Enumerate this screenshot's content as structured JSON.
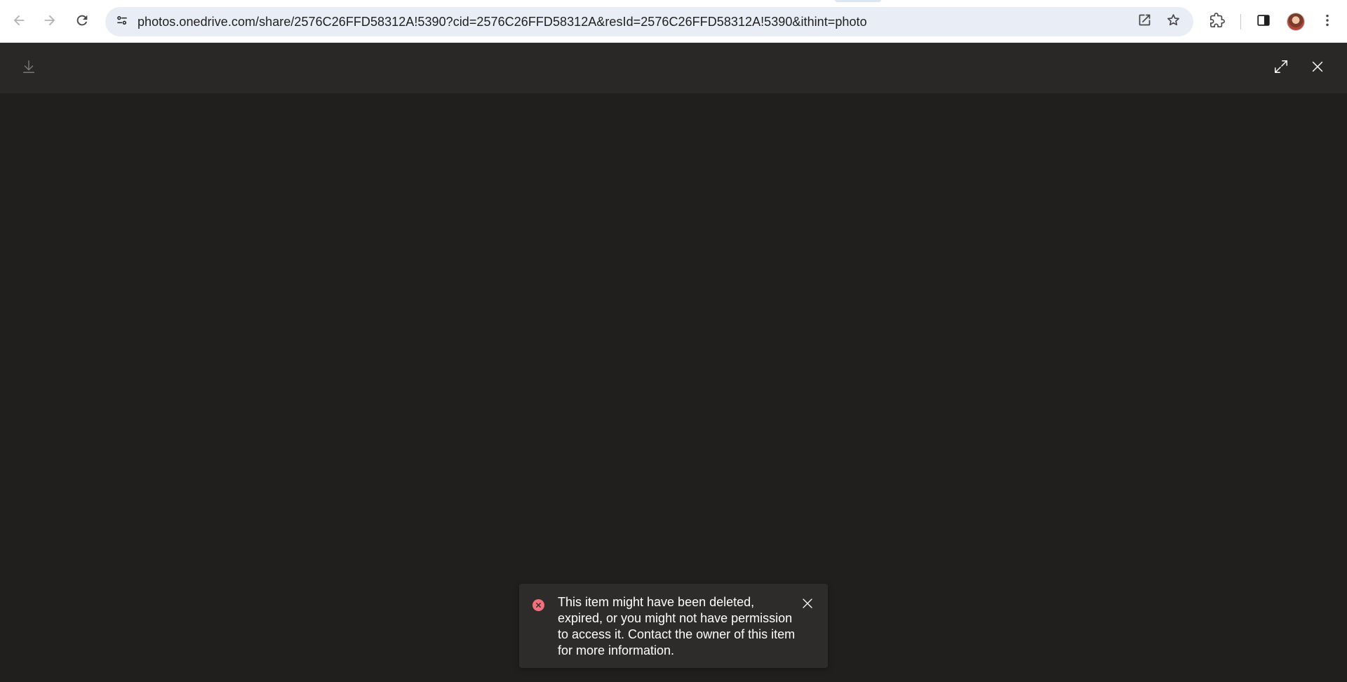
{
  "browser": {
    "url": "photos.onedrive.com/share/2576C26FFD58312A!5390?cid=2576C26FFD58312A&resId=2576C26FFD58312A!5390&ithint=photo",
    "icons": {
      "back": "arrow-left-icon",
      "forward": "arrow-right-icon",
      "reload": "reload-icon",
      "site_info": "tune-icon",
      "open_in_app": "open-external-icon",
      "bookmark": "star-icon",
      "extensions": "puzzle-icon",
      "side_panel": "side-panel-icon",
      "profile": "avatar",
      "menu": "kebab-menu-icon"
    }
  },
  "viewer": {
    "icons": {
      "download": "download-icon",
      "fullscreen": "expand-icon",
      "close": "close-icon"
    }
  },
  "toast": {
    "message": "This item might have been deleted, expired, or you might not have permission to access it. Contact the owner of this item for more information.",
    "icon": "error-icon",
    "error_color": "#f1707b"
  },
  "colors": {
    "chrome_bg": "#ffffff",
    "omnibox_bg": "#e9eef6",
    "viewer_header_bg": "#292827",
    "viewer_bg": "#201f1e",
    "toast_bg": "#2d2c2b"
  }
}
